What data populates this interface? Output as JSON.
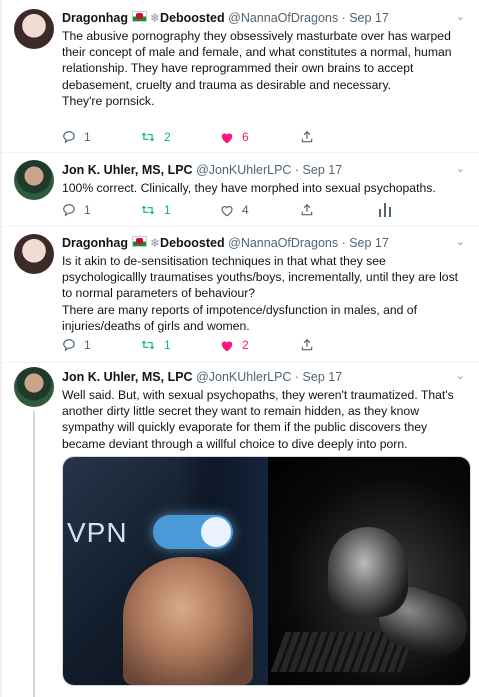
{
  "tweets": [
    {
      "name": "Dragonhag",
      "flag_icon": "wales-flag-icon",
      "snow_icon": "snowflake-icon",
      "name_suffix": "Deboosted",
      "handle": "@NannaOfDragons",
      "date": "· Sep 17",
      "text": "The abusive pornography they obsessively masturbate over has warped their concept of male and female, and what constitutes a normal, human relationship. They have reprogrammed their own brains to accept debasement, cruelty and trauma as desirable and necessary.\nThey're pornsick.",
      "replies": "1",
      "retweets": "2",
      "likes": "6"
    },
    {
      "name": "Jon K. Uhler, MS, LPC",
      "handle": "@JonKUhlerLPC",
      "date": "· Sep 17",
      "text": "100% correct. Clinically, they have morphed into sexual psychopaths.",
      "replies": "1",
      "retweets": "1",
      "likes": "4"
    },
    {
      "name": "Dragonhag",
      "flag_icon": "wales-flag-icon",
      "snow_icon": "snowflake-icon",
      "name_suffix": "Deboosted",
      "handle": "@NannaOfDragons",
      "date": "· Sep 17",
      "text": "Is it akin to de-sensitisation techniques in that what they see psychologicallly traumatises youths/boys, incrementally, until they are lost to normal parameters of behaviour?\nThere are many reports of impotence/dysfunction in males, and of injuries/deaths of girls and women.",
      "replies": "1",
      "retweets": "1",
      "likes": "2"
    },
    {
      "name": "Jon K. Uhler, MS, LPC",
      "handle": "@JonKUhlerLPC",
      "date": "· Sep 17",
      "text": "Well said. But, with sexual psychopaths, they weren't traumatized. That's another dirty little secret they want to remain hidden, as they know sympathy will quickly evaporate for them if the public discovers they became deviant through a willful choice to dive deeply into porn.",
      "media_left_text": "VPN"
    }
  ],
  "colors": {
    "retweet_green": "#00ba7c",
    "like_pink": "#f91880",
    "muted": "#536471"
  }
}
